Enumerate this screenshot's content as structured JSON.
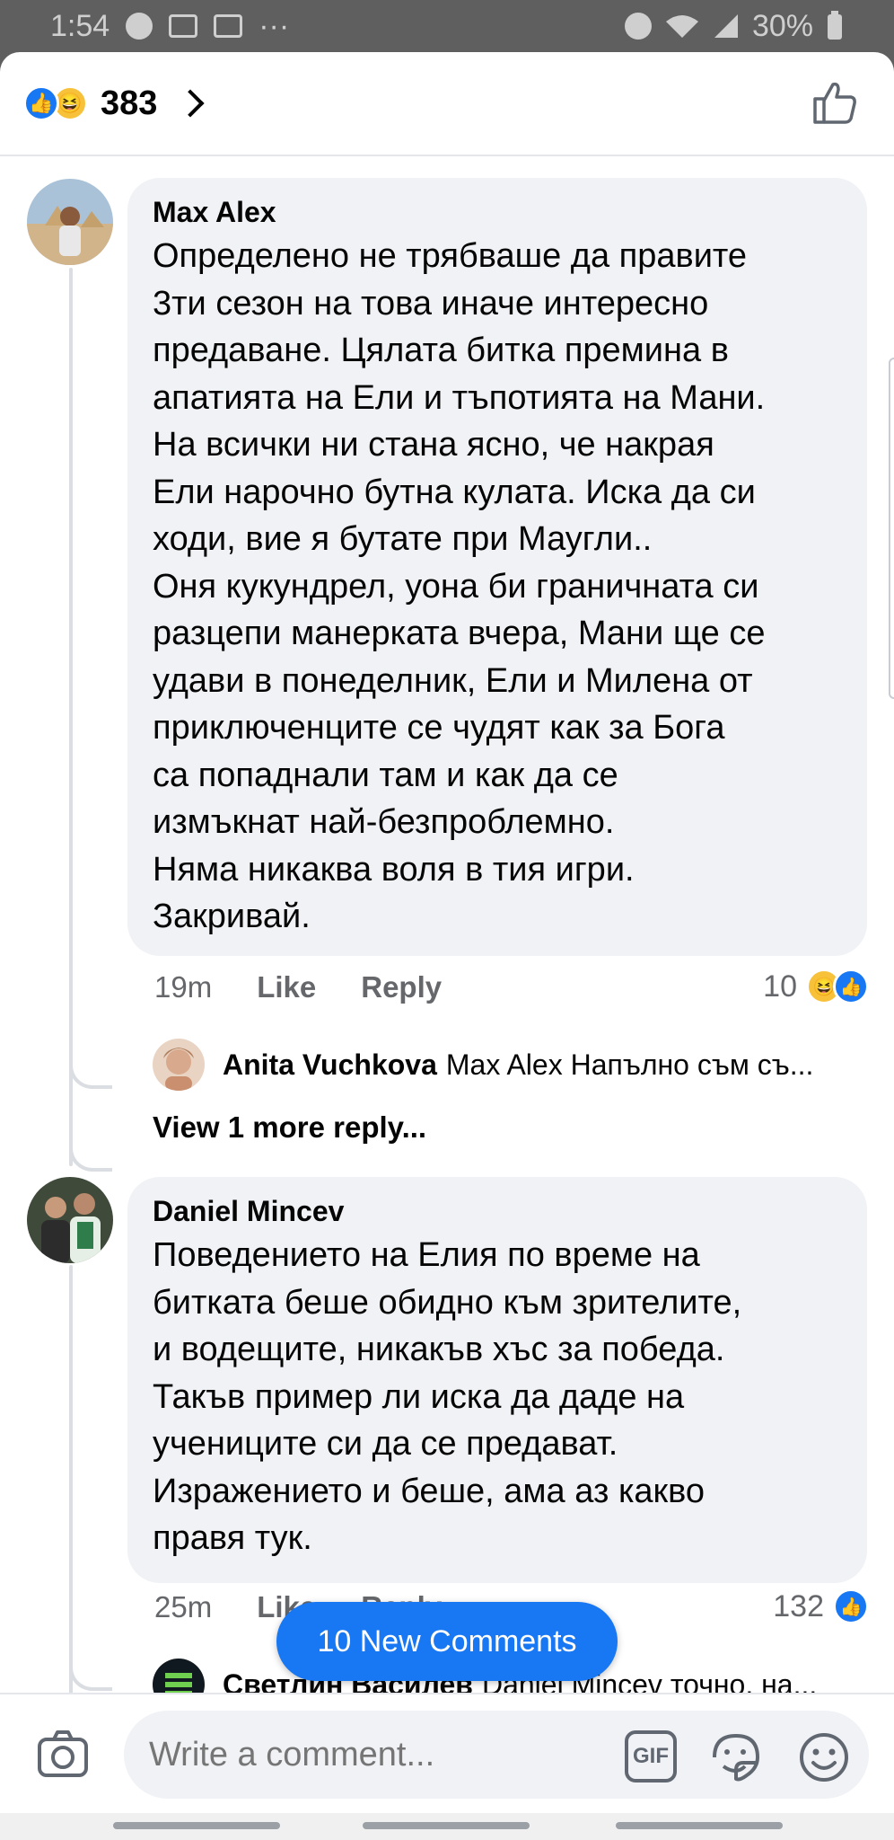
{
  "status_bar": {
    "time": "1:54",
    "dots": "···",
    "battery": "30%"
  },
  "reactions_header": {
    "count": "383"
  },
  "comments": [
    {
      "author": "Max Alex",
      "text": "Определено не трябваше да правите\n3ти сезон на това иначе интересно\nпредаване. Цялата битка премина в\nапатията на Ели и тъпотията на Мани.\nНа всички ни стана ясно, че накрая\nЕли нарочно бутна кулата. Иска да си\nходи, вие я бутате при Маугли..\nОня кукундрел, уона би граничната си\nразцепи манерката вчера, Мани ще се\nудави в понеделник, Ели и Милена от\nприключенците се чудят как за Бога\nса попаднали там и как да се\nизмъкнат най-безпроблемно.\nНяма никаква воля в тия игри.\nЗакривай.",
      "time": "19m",
      "like_label": "Like",
      "reply_label": "Reply",
      "reaction_count": "10",
      "reply": {
        "author": "Anita Vuchkova",
        "text": "Max Alex Напълно съм съ..."
      },
      "view_more": "View 1 more reply..."
    },
    {
      "author": "Daniel Mincev",
      "text": "Поведението на Елия по време на\nбитката беше обидно към зрителите,\nи водещите, никакъв хъс за победа.\nТакъв пример ли иска да даде на\nучениците си да се предават.\nИзражението и беше, ама аз какво\nправя тук.",
      "time": "25m",
      "like_label": "Like",
      "reply_label": "Reply",
      "reaction_count": "132",
      "reply": {
        "author": "Светлин Василев",
        "text": "Daniel Mincev точно, на..."
      }
    }
  ],
  "new_comments_pill": "10 New Comments",
  "composer": {
    "placeholder": "Write a comment...",
    "gif_label": "GIF"
  },
  "colors": {
    "accent": "#1877f2",
    "bubble": "#f0f2f5",
    "secondary_text": "#65676b"
  }
}
